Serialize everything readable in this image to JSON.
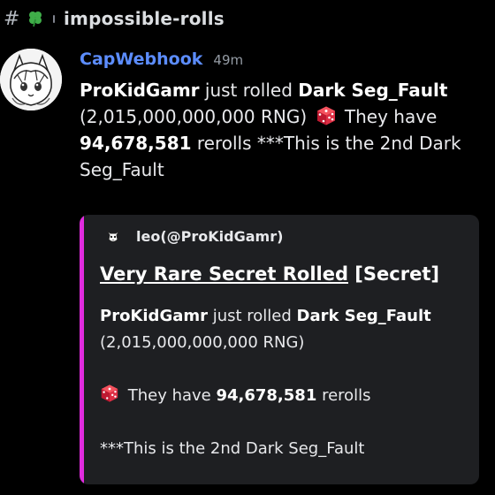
{
  "channel": {
    "hash_icon": "hash-icon",
    "emoji_icon": "four-leaf-clover-icon",
    "name": "impossible-rolls"
  },
  "message": {
    "avatar_icon": "anime-girl-avatar",
    "username": "CapWebhook",
    "timestamp": "49m",
    "username_color": "#5c8dff",
    "body": {
      "player": "ProKidGamr",
      "rolled_text": " just rolled ",
      "item": "Dark Seg_Fault",
      "rng": "(2,015,000,000,000 RNG)",
      "dice_icon": "game-die-icon",
      "have_text": " They have",
      "rerolls_count": "94,678,581",
      "rerolls_text": " rerolls ",
      "ordinal_text": " ***This is the 2nd Dark Seg_Fault"
    }
  },
  "embed": {
    "accent_color": "#e12bdf",
    "author_icon": "dog-icon",
    "author_name": "leo(@ProKidGamr)",
    "title_link": "Very Rare Secret Rolled",
    "title_tag": " [Secret]",
    "desc": {
      "player": "ProKidGamr",
      "rolled_text": " just rolled ",
      "item": "Dark Seg_Fault",
      "rng": "(2,015,000,000,000 RNG)",
      "have_text": " They have ",
      "rerolls_count": "94,678,581",
      "rerolls_text": " rerolls",
      "ordinal_text": "***This is the 2nd Dark Seg_Fault"
    }
  }
}
